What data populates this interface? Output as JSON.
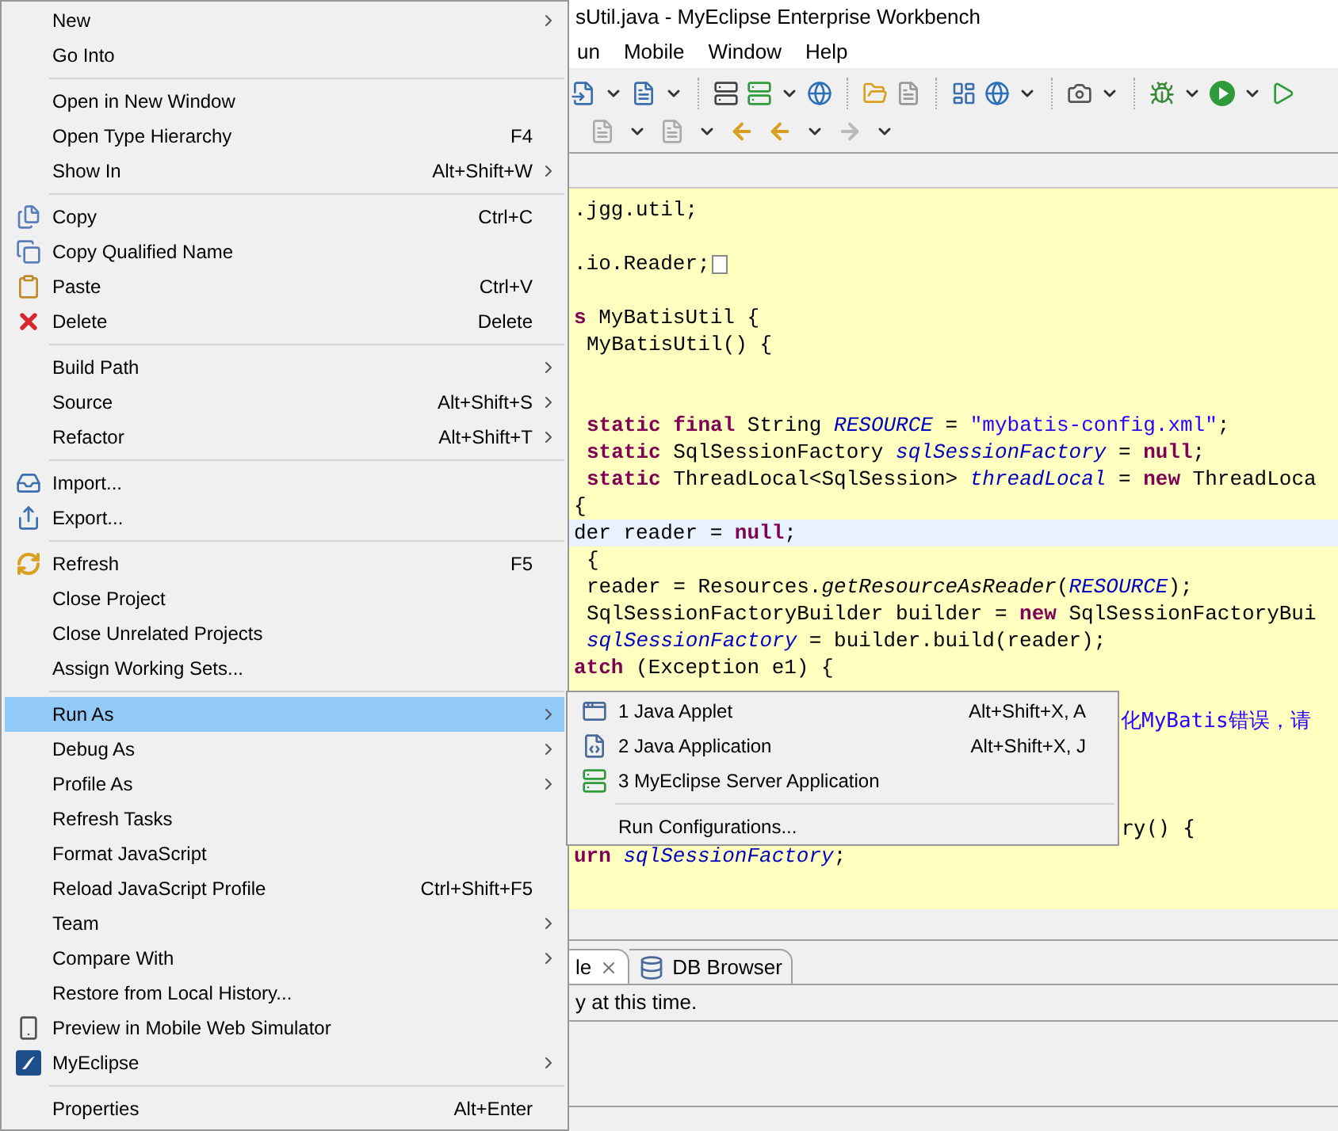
{
  "window": {
    "title": "sUtil.java - MyEclipse Enterprise Workbench"
  },
  "menu_bar": [
    {
      "label": "un"
    },
    {
      "label": "Mobile"
    },
    {
      "label": "Window"
    },
    {
      "label": "Help"
    }
  ],
  "editor": {
    "lines": [
      {
        "kind": "code",
        "segments": [
          {
            "kind": "plain",
            "text": ".jgg.util;"
          }
        ]
      },
      {
        "kind": "blank"
      },
      {
        "kind": "code",
        "folded": true,
        "segments": [
          {
            "kind": "plain",
            "text": ".io.Reader;"
          }
        ]
      },
      {
        "kind": "blank"
      },
      {
        "kind": "code",
        "segments": [
          {
            "kind": "keyword",
            "text": "s"
          },
          {
            "kind": "plain",
            "text": " MyBatisUtil {"
          }
        ]
      },
      {
        "kind": "code",
        "indented": true,
        "segments": [
          {
            "kind": "plain",
            "text": "MyBatisUtil() {"
          }
        ]
      },
      {
        "kind": "blank"
      },
      {
        "kind": "blank"
      },
      {
        "kind": "code",
        "indented": true,
        "segments": [
          {
            "kind": "keyword",
            "text": "static final"
          },
          {
            "kind": "plain",
            "text": " String "
          },
          {
            "kind": "field",
            "text": "RESOURCE"
          },
          {
            "kind": "plain",
            "text": " = "
          },
          {
            "kind": "string",
            "text": "\"mybatis-config.xml\""
          },
          {
            "kind": "plain",
            "text": ";"
          }
        ]
      },
      {
        "kind": "code",
        "indented": true,
        "segments": [
          {
            "kind": "keyword",
            "text": "static"
          },
          {
            "kind": "plain",
            "text": " SqlSessionFactory "
          },
          {
            "kind": "field",
            "text": "sqlSessionFactory"
          },
          {
            "kind": "plain",
            "text": " = "
          },
          {
            "kind": "keyword",
            "text": "null"
          },
          {
            "kind": "plain",
            "text": ";"
          }
        ]
      },
      {
        "kind": "code",
        "indented": true,
        "segments": [
          {
            "kind": "keyword",
            "text": "static"
          },
          {
            "kind": "plain",
            "text": " ThreadLocal<SqlSession> "
          },
          {
            "kind": "field",
            "text": "threadLocal"
          },
          {
            "kind": "plain",
            "text": " = "
          },
          {
            "kind": "keyword",
            "text": "new"
          },
          {
            "kind": "plain",
            "text": " ThreadLoca"
          }
        ]
      },
      {
        "kind": "code",
        "segments": [
          {
            "kind": "plain",
            "text": "{"
          }
        ]
      },
      {
        "kind": "code",
        "current": true,
        "segments": [
          {
            "kind": "plain",
            "text": "der reader = "
          },
          {
            "kind": "keyword",
            "text": "null"
          },
          {
            "kind": "plain",
            "text": ";"
          }
        ]
      },
      {
        "kind": "code",
        "indented": true,
        "segments": [
          {
            "kind": "plain",
            "text": "{"
          }
        ]
      },
      {
        "kind": "code",
        "indented": true,
        "segments": [
          {
            "kind": "plain",
            "text": "reader = Resources."
          },
          {
            "kind": "method",
            "text": "getResourceAsReader"
          },
          {
            "kind": "plain",
            "text": "("
          },
          {
            "kind": "field",
            "text": "RESOURCE"
          },
          {
            "kind": "plain",
            "text": ");"
          }
        ]
      },
      {
        "kind": "code",
        "indented": true,
        "segments": [
          {
            "kind": "plain",
            "text": "SqlSessionFactoryBuilder builder = "
          },
          {
            "kind": "keyword",
            "text": "new"
          },
          {
            "kind": "plain",
            "text": " SqlSessionFactoryBui"
          }
        ]
      },
      {
        "kind": "code",
        "indented": true,
        "segments": [
          {
            "kind": "field",
            "text": "sqlSessionFactory"
          },
          {
            "kind": "plain",
            "text": " = builder.build(reader);"
          }
        ]
      },
      {
        "kind": "code",
        "segments": [
          {
            "kind": "keyword",
            "text": "atch"
          },
          {
            "kind": "plain",
            "text": " (Exception e1) {"
          }
        ]
      },
      {
        "kind": "blank"
      },
      {
        "kind": "right_of_menu",
        "segments": [
          {
            "kind": "string",
            "text": "化MyBatis错误，请"
          }
        ]
      },
      {
        "kind": "blank"
      },
      {
        "kind": "blank"
      },
      {
        "kind": "blank"
      },
      {
        "kind": "right_of_menu",
        "segments": [
          {
            "kind": "plain",
            "text": "ry() {"
          }
        ]
      },
      {
        "kind": "code",
        "segments": [
          {
            "kind": "keyword",
            "text": "urn "
          },
          {
            "kind": "field",
            "text": "sqlSessionFactory"
          },
          {
            "kind": "plain",
            "text": ";"
          }
        ]
      }
    ]
  },
  "bottom_panel": {
    "tabs": [
      {
        "label": "le",
        "selected": true,
        "closable": true
      },
      {
        "label": "DB Browser",
        "selected": false,
        "closable": false
      }
    ],
    "message": "y at this time."
  },
  "context_menu": {
    "groups": [
      [
        {
          "label": "New",
          "submenu": true,
          "selected": false
        },
        {
          "label": "Go Into",
          "submenu": false,
          "selected": false
        }
      ],
      [
        {
          "label": "Open in New Window",
          "submenu": false,
          "selected": false
        },
        {
          "label": "Open Type Hierarchy",
          "shortcut": "F4",
          "submenu": false,
          "selected": false
        },
        {
          "label": "Show In",
          "shortcut": "Alt+Shift+W",
          "submenu": true,
          "selected": false
        }
      ],
      [
        {
          "label": "Copy",
          "shortcut": "Ctrl+C",
          "kind": "copy",
          "submenu": false,
          "selected": false
        },
        {
          "label": "Copy Qualified Name",
          "kind": "copy-name",
          "submenu": false,
          "selected": false
        },
        {
          "label": "Paste",
          "shortcut": "Ctrl+V",
          "kind": "paste",
          "submenu": false,
          "selected": false
        },
        {
          "label": "Delete",
          "shortcut": "Delete",
          "kind": "delete",
          "submenu": false,
          "selected": false
        }
      ],
      [
        {
          "label": "Build Path",
          "submenu": true,
          "selected": false
        },
        {
          "label": "Source",
          "shortcut": "Alt+Shift+S",
          "submenu": true,
          "selected": false
        },
        {
          "label": "Refactor",
          "shortcut": "Alt+Shift+T",
          "submenu": true,
          "selected": false
        }
      ],
      [
        {
          "label": "Import...",
          "kind": "import",
          "submenu": false,
          "selected": false
        },
        {
          "label": "Export...",
          "kind": "export",
          "submenu": false,
          "selected": false
        }
      ],
      [
        {
          "label": "Refresh",
          "shortcut": "F5",
          "kind": "refresh",
          "submenu": false,
          "selected": false
        },
        {
          "label": "Close Project",
          "submenu": false,
          "selected": false
        },
        {
          "label": "Close Unrelated Projects",
          "submenu": false,
          "selected": false
        },
        {
          "label": "Assign Working Sets...",
          "submenu": false,
          "selected": false
        }
      ],
      [
        {
          "label": "Run As",
          "submenu": true,
          "selected": true
        },
        {
          "label": "Debug As",
          "submenu": true,
          "selected": false
        },
        {
          "label": "Profile As",
          "submenu": true,
          "selected": false
        },
        {
          "label": "Refresh Tasks",
          "submenu": false,
          "selected": false
        },
        {
          "label": "Format JavaScript",
          "submenu": false,
          "selected": false
        },
        {
          "label": "Reload JavaScript Profile",
          "shortcut": "Ctrl+Shift+F5",
          "submenu": false,
          "selected": false
        },
        {
          "label": "Team",
          "submenu": true,
          "selected": false
        },
        {
          "label": "Compare With",
          "submenu": true,
          "selected": false
        },
        {
          "label": "Restore from Local History...",
          "submenu": false,
          "selected": false
        },
        {
          "label": "Preview in Mobile Web Simulator",
          "kind": "mobile",
          "submenu": false,
          "selected": false
        },
        {
          "label": "MyEclipse",
          "kind": "myeclipse",
          "submenu": true,
          "selected": false
        }
      ],
      [
        {
          "label": "Properties",
          "shortcut": "Alt+Enter",
          "submenu": false,
          "selected": false
        }
      ]
    ]
  },
  "run_as_submenu": {
    "groups": [
      [
        {
          "label": "1 Java Applet",
          "shortcut": "Alt+Shift+X, A",
          "kind": "applet",
          "selected": false
        },
        {
          "label": "2 Java Application",
          "shortcut": "Alt+Shift+X, J",
          "kind": "java-app",
          "selected": false
        },
        {
          "label": "3 MyEclipse Server Application",
          "kind": "server",
          "selected": false
        }
      ],
      [
        {
          "label": "Run Configurations...",
          "selected": false
        }
      ]
    ]
  }
}
